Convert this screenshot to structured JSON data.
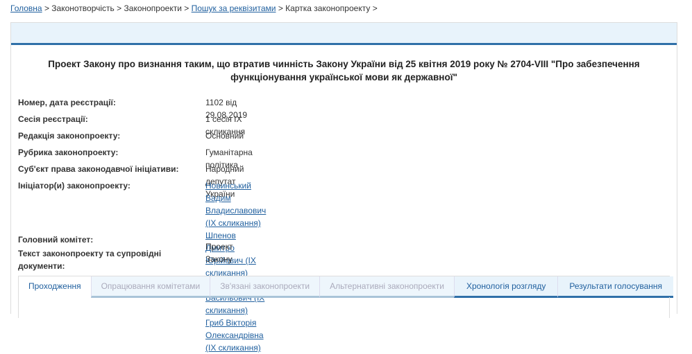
{
  "breadcrumb": [
    {
      "label": "Головна",
      "link": true
    },
    {
      "label": "Законотворчість",
      "link": false
    },
    {
      "label": "Законопроекти",
      "link": false
    },
    {
      "label": "Пошук за реквізитами",
      "link": true
    },
    {
      "label": "Картка законопроекту",
      "link": false
    }
  ],
  "separator": ">",
  "title": "Проект Закону про визнання таким, що втратив чинність Закону України від 25 квітня 2019 року № 2704-VIII \"Про забезпечення функціонування української мови як державної\"",
  "fields": [
    {
      "label": "Номер, дата реєстрації:",
      "value": "1102 від 29.08.2019"
    },
    {
      "label": "Сесія реєстрації:",
      "value": "1 сесія IX скликання"
    },
    {
      "label": "Редакція законопроекту:",
      "value": "Основний"
    },
    {
      "label": "Рубрика законопроекту:",
      "value": "Гуманітарна політика"
    },
    {
      "label": "Суб'єкт права законодавчої ініціативи:",
      "value": "Народний депутат України"
    }
  ],
  "initiators_label": "Ініціатор(и) законопроекту:",
  "initiators": [
    "Новинський Вадим Владиславович (IX скликання)",
    "Шпенов Дмитро Юрійович (IX скликання)",
    "Магера Сергій Васильович (IX скликання)",
    "Гриб Вікторія Олександрівна (IX скликання)"
  ],
  "committee_label": "Головний комітет:",
  "docs_label": "Текст законопроекту та супровідні документи:",
  "docs_value": "Проект Закону",
  "tabs": [
    "Проходження",
    "Опрацювання комітетами",
    "Зв'язані законопроекти",
    "Альтернативні законопроекти",
    "Хронологія розгляду",
    "Результати голосування"
  ]
}
